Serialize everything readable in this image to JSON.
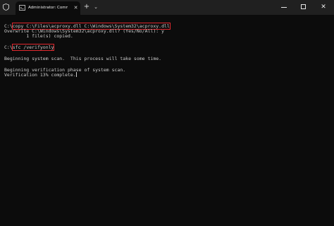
{
  "window": {
    "tab_title": "Administrator: Command Prom",
    "tab_close_glyph": "✕",
    "new_tab_glyph": "+",
    "dropdown_glyph": "⌄",
    "close_glyph": "✕"
  },
  "terminal": {
    "line1_prompt": "C:\\",
    "line1_command": "copy C:\\Files\\acproxy.dll C:\\Windows\\System32\\acproxy.dll",
    "line2": "Overwrite C:\\Windows\\System32\\acproxy.dll? (Yes/No/All): y",
    "line3": "        1 file(s) copied.",
    "line4_prompt": "C:\\",
    "line4_command": "sfc /verifyonly",
    "line5": "Beginning system scan.  This process will take some time.",
    "line6": "Beginning verification phase of system scan.",
    "line7": "Verification 13% complete."
  },
  "colors": {
    "titlebar": "#202020",
    "terminal_bg": "#0c0c0c",
    "text": "#cccccc",
    "highlight": "#e0282e"
  },
  "icons": [
    "shield-icon",
    "terminal-icon",
    "close-icon",
    "plus-icon",
    "chevron-down-icon",
    "minimize-icon",
    "maximize-icon"
  ]
}
